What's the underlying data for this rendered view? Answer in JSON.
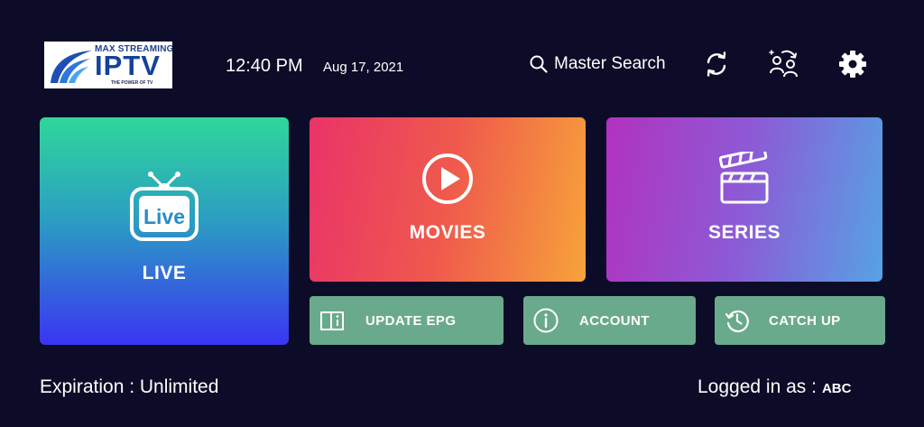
{
  "logo": {
    "top_text": "MAX STREAMING",
    "main_text": "IPTV",
    "tagline": "THE POWER OF TV"
  },
  "header": {
    "time": "12:40 PM",
    "date": "Aug 17, 2021",
    "search_label": "Master Search",
    "icons": [
      "search-icon",
      "refresh-icon",
      "switch-user-icon",
      "settings-gear-icon"
    ]
  },
  "tiles": {
    "live": {
      "label": "LIVE",
      "icon_text": "Live"
    },
    "movies": {
      "label": "MOVIES"
    },
    "series": {
      "label": "SERIES"
    }
  },
  "actions": {
    "update_epg": "UPDATE EPG",
    "account": "ACCOUNT",
    "catch_up": "CATCH UP"
  },
  "footer": {
    "expiration": "Expiration : Unlimited",
    "logged_in_label": "Logged in as :",
    "username": "ABC"
  },
  "colors": {
    "background": "#0c0c28",
    "live_gradient": [
      "#2fd79a",
      "#3b34f2"
    ],
    "movies_gradient": [
      "#ea3368",
      "#f7a33a"
    ],
    "series_gradient": [
      "#b232bf",
      "#56a2e4"
    ],
    "action_button": "#6aaa8c"
  }
}
